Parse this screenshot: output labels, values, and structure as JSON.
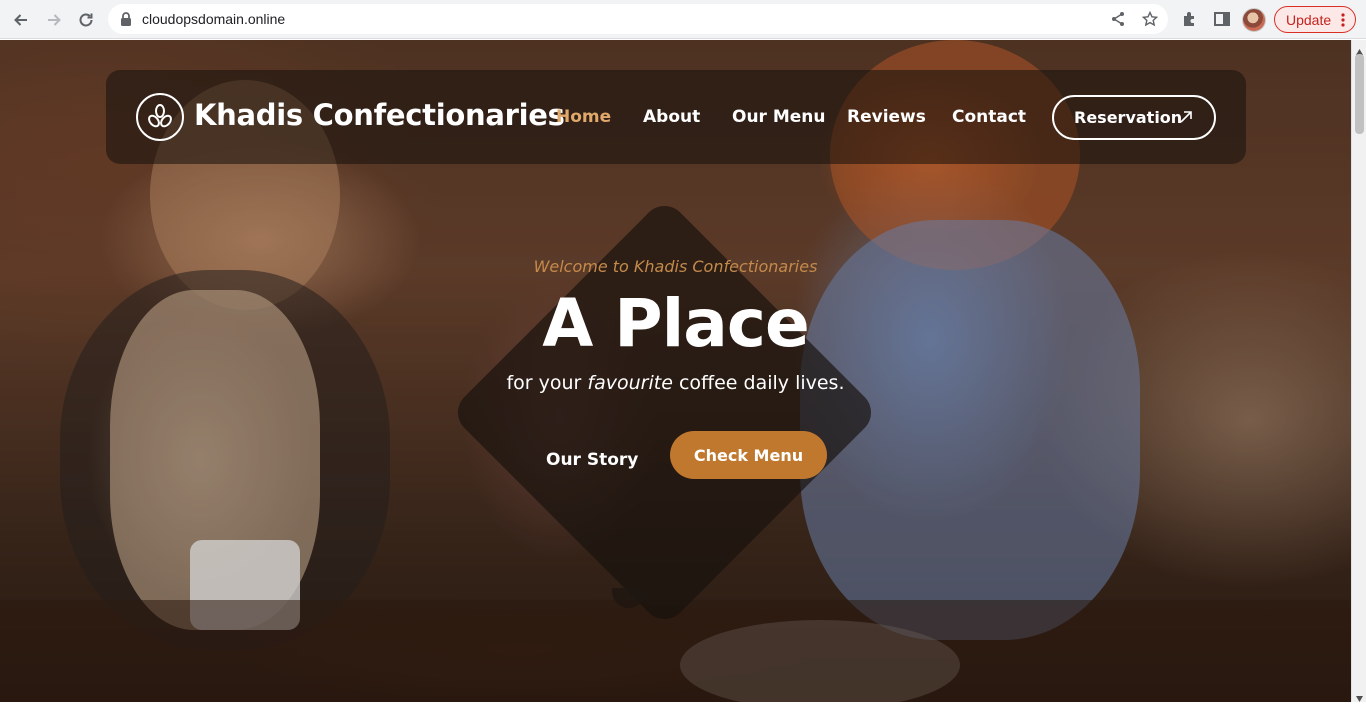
{
  "browser": {
    "url": "cloudopsdomain.online",
    "update_label": "Update"
  },
  "site": {
    "brand": "Khadis Confectionaries",
    "nav": [
      {
        "label": "Home",
        "active": true
      },
      {
        "label": "About",
        "active": false
      },
      {
        "label": "Our Menu",
        "active": false
      },
      {
        "label": "Reviews",
        "active": false
      },
      {
        "label": "Contact",
        "active": false
      }
    ],
    "reservation_label": "Reservation"
  },
  "hero": {
    "welcome": "Welcome to Khadis Confectionaries",
    "headline": "A Place",
    "tagline_prefix": "for your ",
    "tagline_em": "favourite",
    "tagline_suffix": " coffee daily lives.",
    "story_button": "Our Story",
    "menu_button": "Check Menu"
  },
  "colors": {
    "accent": "#c0782f",
    "active_nav": "#e0a86a",
    "welcome_text": "#c48a4c"
  }
}
